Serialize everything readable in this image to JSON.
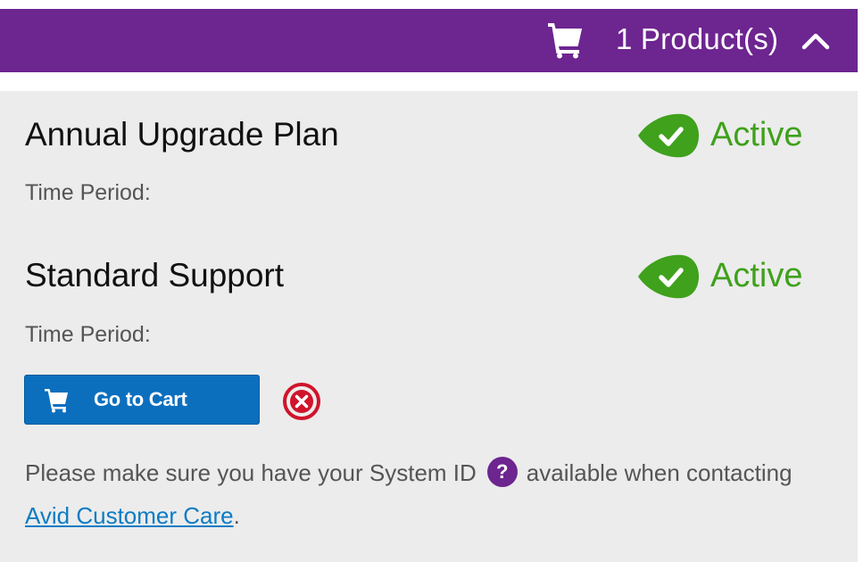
{
  "header": {
    "cart_icon": "cart-icon",
    "product_count_label": "1 Product(s)",
    "collapse_icon": "chevron-up-icon",
    "background_color": "#6d2590"
  },
  "products": [
    {
      "title": "Annual Upgrade Plan",
      "time_period_label": "Time Period:",
      "status": "Active"
    },
    {
      "title": "Standard Support",
      "time_period_label": "Time Period:",
      "status": "Active"
    }
  ],
  "actions": {
    "go_to_cart_label": "Go to Cart",
    "go_to_cart_icon": "cart-icon",
    "remove_icon": "close-circle-icon",
    "button_color": "#0c6fbe",
    "remove_color": "#d0142b"
  },
  "note": {
    "text_before": "Please make sure you have your System ID",
    "help_icon": "?",
    "text_after": "available when contacting",
    "link_text": "Avid Customer Care",
    "text_end": "."
  },
  "colors": {
    "status_active": "#3fa11c",
    "link": "#0c7cc4",
    "panel_background": "#ececec"
  }
}
